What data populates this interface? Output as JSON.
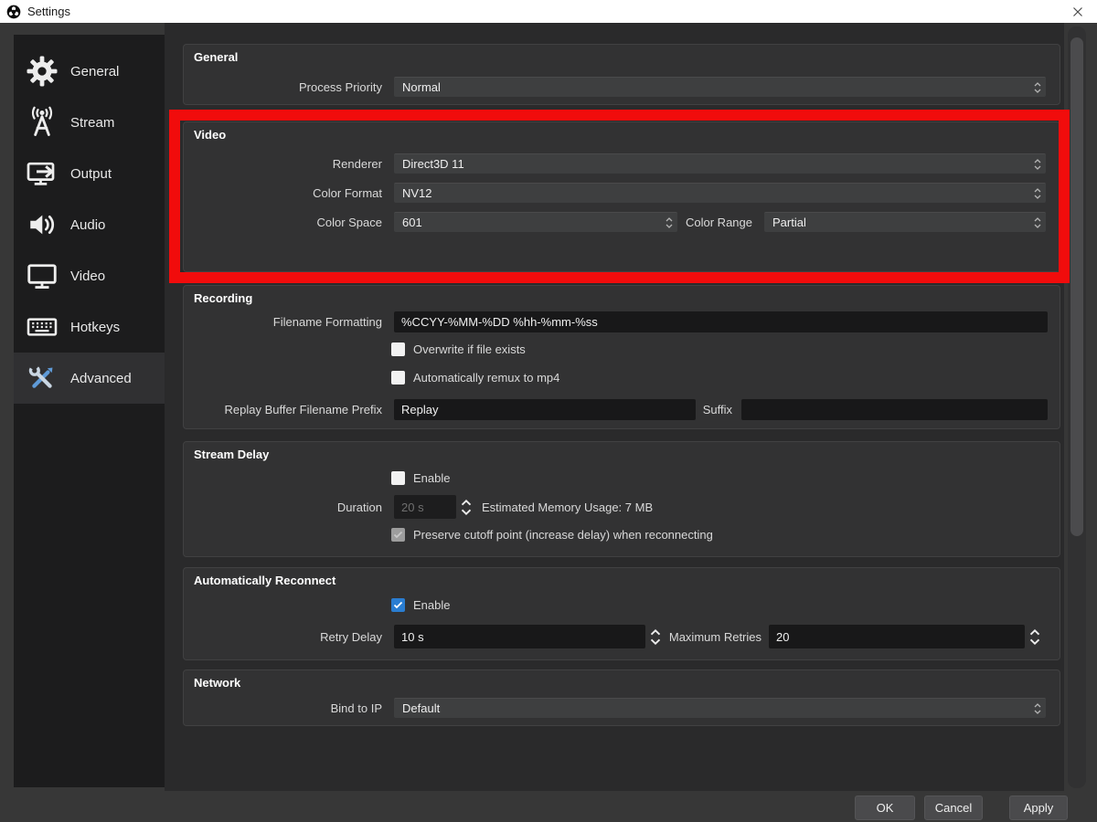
{
  "window": {
    "title": "Settings"
  },
  "sidebar": {
    "items": [
      {
        "label": "General",
        "icon": "gear-icon",
        "selected": false
      },
      {
        "label": "Stream",
        "icon": "broadcast-icon",
        "selected": false
      },
      {
        "label": "Output",
        "icon": "output-icon",
        "selected": false
      },
      {
        "label": "Audio",
        "icon": "speaker-icon",
        "selected": false
      },
      {
        "label": "Video",
        "icon": "monitor-icon",
        "selected": false
      },
      {
        "label": "Hotkeys",
        "icon": "keyboard-icon",
        "selected": false
      },
      {
        "label": "Advanced",
        "icon": "tools-icon",
        "selected": true
      }
    ]
  },
  "general": {
    "title": "General",
    "process_priority_label": "Process Priority",
    "process_priority_value": "Normal"
  },
  "video": {
    "title": "Video",
    "renderer_label": "Renderer",
    "renderer_value": "Direct3D 11",
    "color_format_label": "Color Format",
    "color_format_value": "NV12",
    "color_space_label": "Color Space",
    "color_space_value": "601",
    "color_range_label": "Color Range",
    "color_range_value": "Partial"
  },
  "recording": {
    "title": "Recording",
    "filename_formatting_label": "Filename Formatting",
    "filename_formatting_value": "%CCYY-%MM-%DD %hh-%mm-%ss",
    "overwrite_label": "Overwrite if file exists",
    "overwrite_checked": false,
    "remux_label": "Automatically remux to mp4",
    "remux_checked": false,
    "replay_prefix_label": "Replay Buffer Filename Prefix",
    "replay_prefix_value": "Replay",
    "suffix_label": "Suffix",
    "suffix_value": ""
  },
  "stream_delay": {
    "title": "Stream Delay",
    "enable_label": "Enable",
    "enable_checked": false,
    "duration_label": "Duration",
    "duration_value": "20 s",
    "duration_enabled": false,
    "memory_usage_text": "Estimated Memory Usage: 7 MB",
    "preserve_label": "Preserve cutoff point (increase delay) when reconnecting",
    "preserve_checked": true,
    "preserve_enabled": false
  },
  "auto_reconnect": {
    "title": "Automatically Reconnect",
    "enable_label": "Enable",
    "enable_checked": true,
    "retry_delay_label": "Retry Delay",
    "retry_delay_value": "10 s",
    "max_retries_label": "Maximum Retries",
    "max_retries_value": "20"
  },
  "network": {
    "title": "Network",
    "bind_ip_label": "Bind to IP",
    "bind_ip_value": "Default"
  },
  "footer": {
    "ok": "OK",
    "cancel": "Cancel",
    "apply": "Apply"
  },
  "annotation": {
    "type": "red-rectangle-highlight",
    "color": "#f10c0c",
    "highlights": "Video section"
  },
  "colors": {
    "accent_blue": "#2a7dd1",
    "titlebar_bg": "#ffffff",
    "window_bg": "#373737",
    "viewport_bg": "#2a2a2b",
    "group_bg": "#323233",
    "sidebar_bg": "#1c1c1d",
    "input_bg": "#181819",
    "annotation_red": "#f10c0c"
  }
}
